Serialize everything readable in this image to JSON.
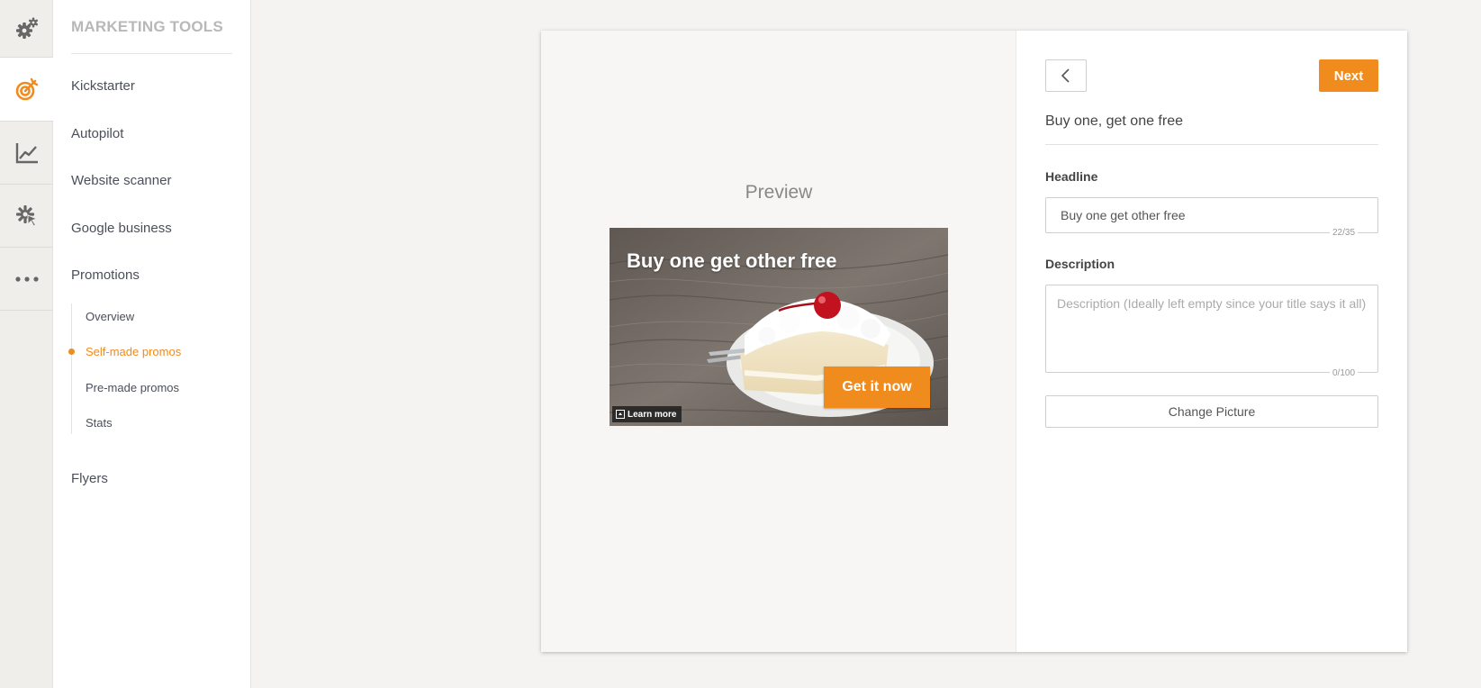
{
  "rail": {
    "items": [
      {
        "icon": "gears-icon",
        "active": false
      },
      {
        "icon": "target-icon",
        "active": true
      },
      {
        "icon": "chart-line-icon",
        "active": false
      },
      {
        "icon": "cursor-click-icon",
        "active": false
      },
      {
        "icon": "more-dots-icon",
        "active": false
      }
    ]
  },
  "sidebar": {
    "title": "MARKETING TOOLS",
    "items": [
      {
        "label": "Kickstarter"
      },
      {
        "label": "Autopilot"
      },
      {
        "label": "Website scanner"
      },
      {
        "label": "Google business"
      },
      {
        "label": "Promotions"
      },
      {
        "label": "Flyers"
      }
    ],
    "promotions_sub": [
      {
        "label": "Overview"
      },
      {
        "label": "Self-made promos",
        "active": true
      },
      {
        "label": "Pre-made promos"
      },
      {
        "label": "Stats"
      }
    ]
  },
  "preview": {
    "label": "Preview",
    "ad": {
      "headline": "Buy one get other free",
      "cta": "Get it now",
      "learn_more": "Learn more"
    }
  },
  "form": {
    "next_label": "Next",
    "title": "Buy one, get one free",
    "headline_label": "Headline",
    "headline_value": "Buy one get other free",
    "headline_counter": "22/35",
    "description_label": "Description",
    "description_placeholder": "Description (Ideally left empty since your title says it all)",
    "description_value": "",
    "description_counter": "0/100",
    "change_picture_label": "Change Picture"
  },
  "colors": {
    "accent": "#f08b1d",
    "rail_bg": "#efeeeb",
    "page_bg": "#f4f3f1"
  }
}
